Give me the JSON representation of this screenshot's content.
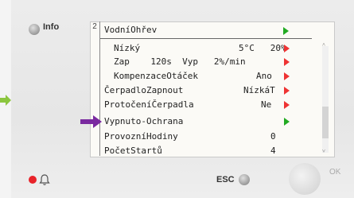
{
  "header": {
    "info_label": "Info",
    "page_number": "2",
    "title": "VodníOhřev"
  },
  "rows": [
    {
      "label": "Nízký",
      "value": "5°C   20%",
      "arrow": "red"
    },
    {
      "label": "Zap    120s  Vyp   2%/min",
      "value": "",
      "arrow": "red"
    },
    {
      "label": "KompenzaceOtáček",
      "value": "Ano",
      "arrow": "red"
    },
    {
      "label": "ČerpadloZapnout",
      "value": "NízkáT",
      "arrow": "red"
    },
    {
      "label": "ProtočeníČerpadla",
      "value": "Ne",
      "arrow": "red"
    },
    {
      "label": "Vypnuto-Ochrana",
      "value": "",
      "arrow": "green"
    },
    {
      "label": "ProvozníHodiny",
      "value": "0",
      "arrow": ""
    },
    {
      "label": "PočetStartů",
      "value": "4",
      "arrow": ""
    }
  ],
  "footer": {
    "esc_label": "ESC",
    "ok_label": "OK"
  },
  "colors": {
    "red_arrow": "#e33333",
    "green_arrow": "#22aa22",
    "pointer_arrow": "#7a2aa0",
    "alarm": "#e8232a"
  },
  "icons": {
    "nav_arrow": "green-arrow-icon",
    "pointer": "purple-arrow-icon",
    "alarm": "bell-icon"
  }
}
